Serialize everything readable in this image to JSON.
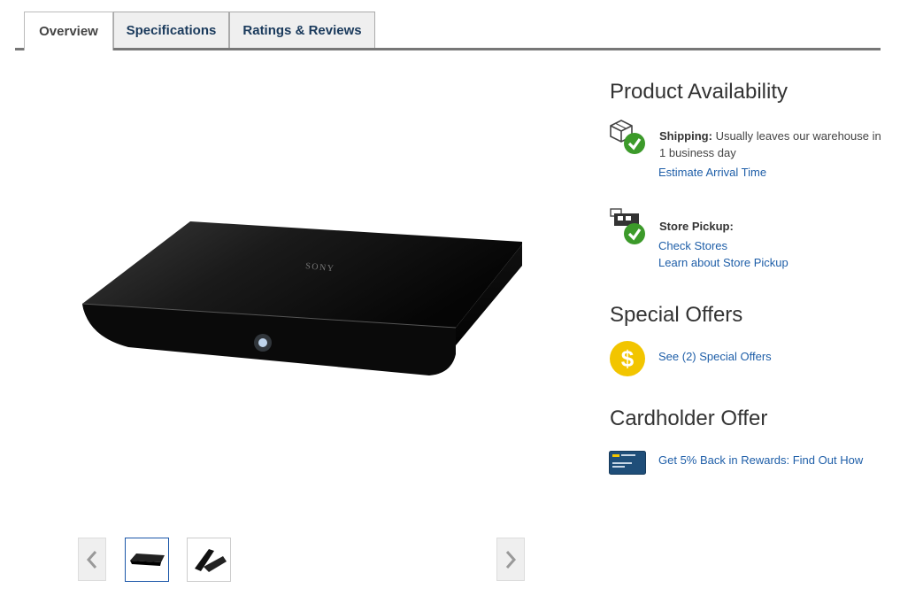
{
  "tabs": [
    {
      "label": "Overview",
      "active": true
    },
    {
      "label": "Specifications",
      "active": false
    },
    {
      "label": "Ratings & Reviews",
      "active": false
    }
  ],
  "product": {
    "brand_mark": "SONY"
  },
  "availability": {
    "title": "Product Availability",
    "shipping": {
      "label": "Shipping:",
      "text": "Usually leaves our warehouse in 1 business day",
      "link": "Estimate Arrival Time"
    },
    "pickup": {
      "label": "Store Pickup:",
      "links": [
        "Check Stores",
        "Learn about Store Pickup"
      ]
    }
  },
  "special_offers": {
    "title": "Special Offers",
    "link": "See (2) Special Offers",
    "icon_symbol": "$"
  },
  "cardholder": {
    "title": "Cardholder Offer",
    "link": "Get 5% Back in Rewards: Find Out How"
  },
  "colors": {
    "link": "#1e5ea8",
    "check_green": "#3c9a2a",
    "coin_yellow": "#f2c500",
    "card_blue": "#1f4e79"
  }
}
